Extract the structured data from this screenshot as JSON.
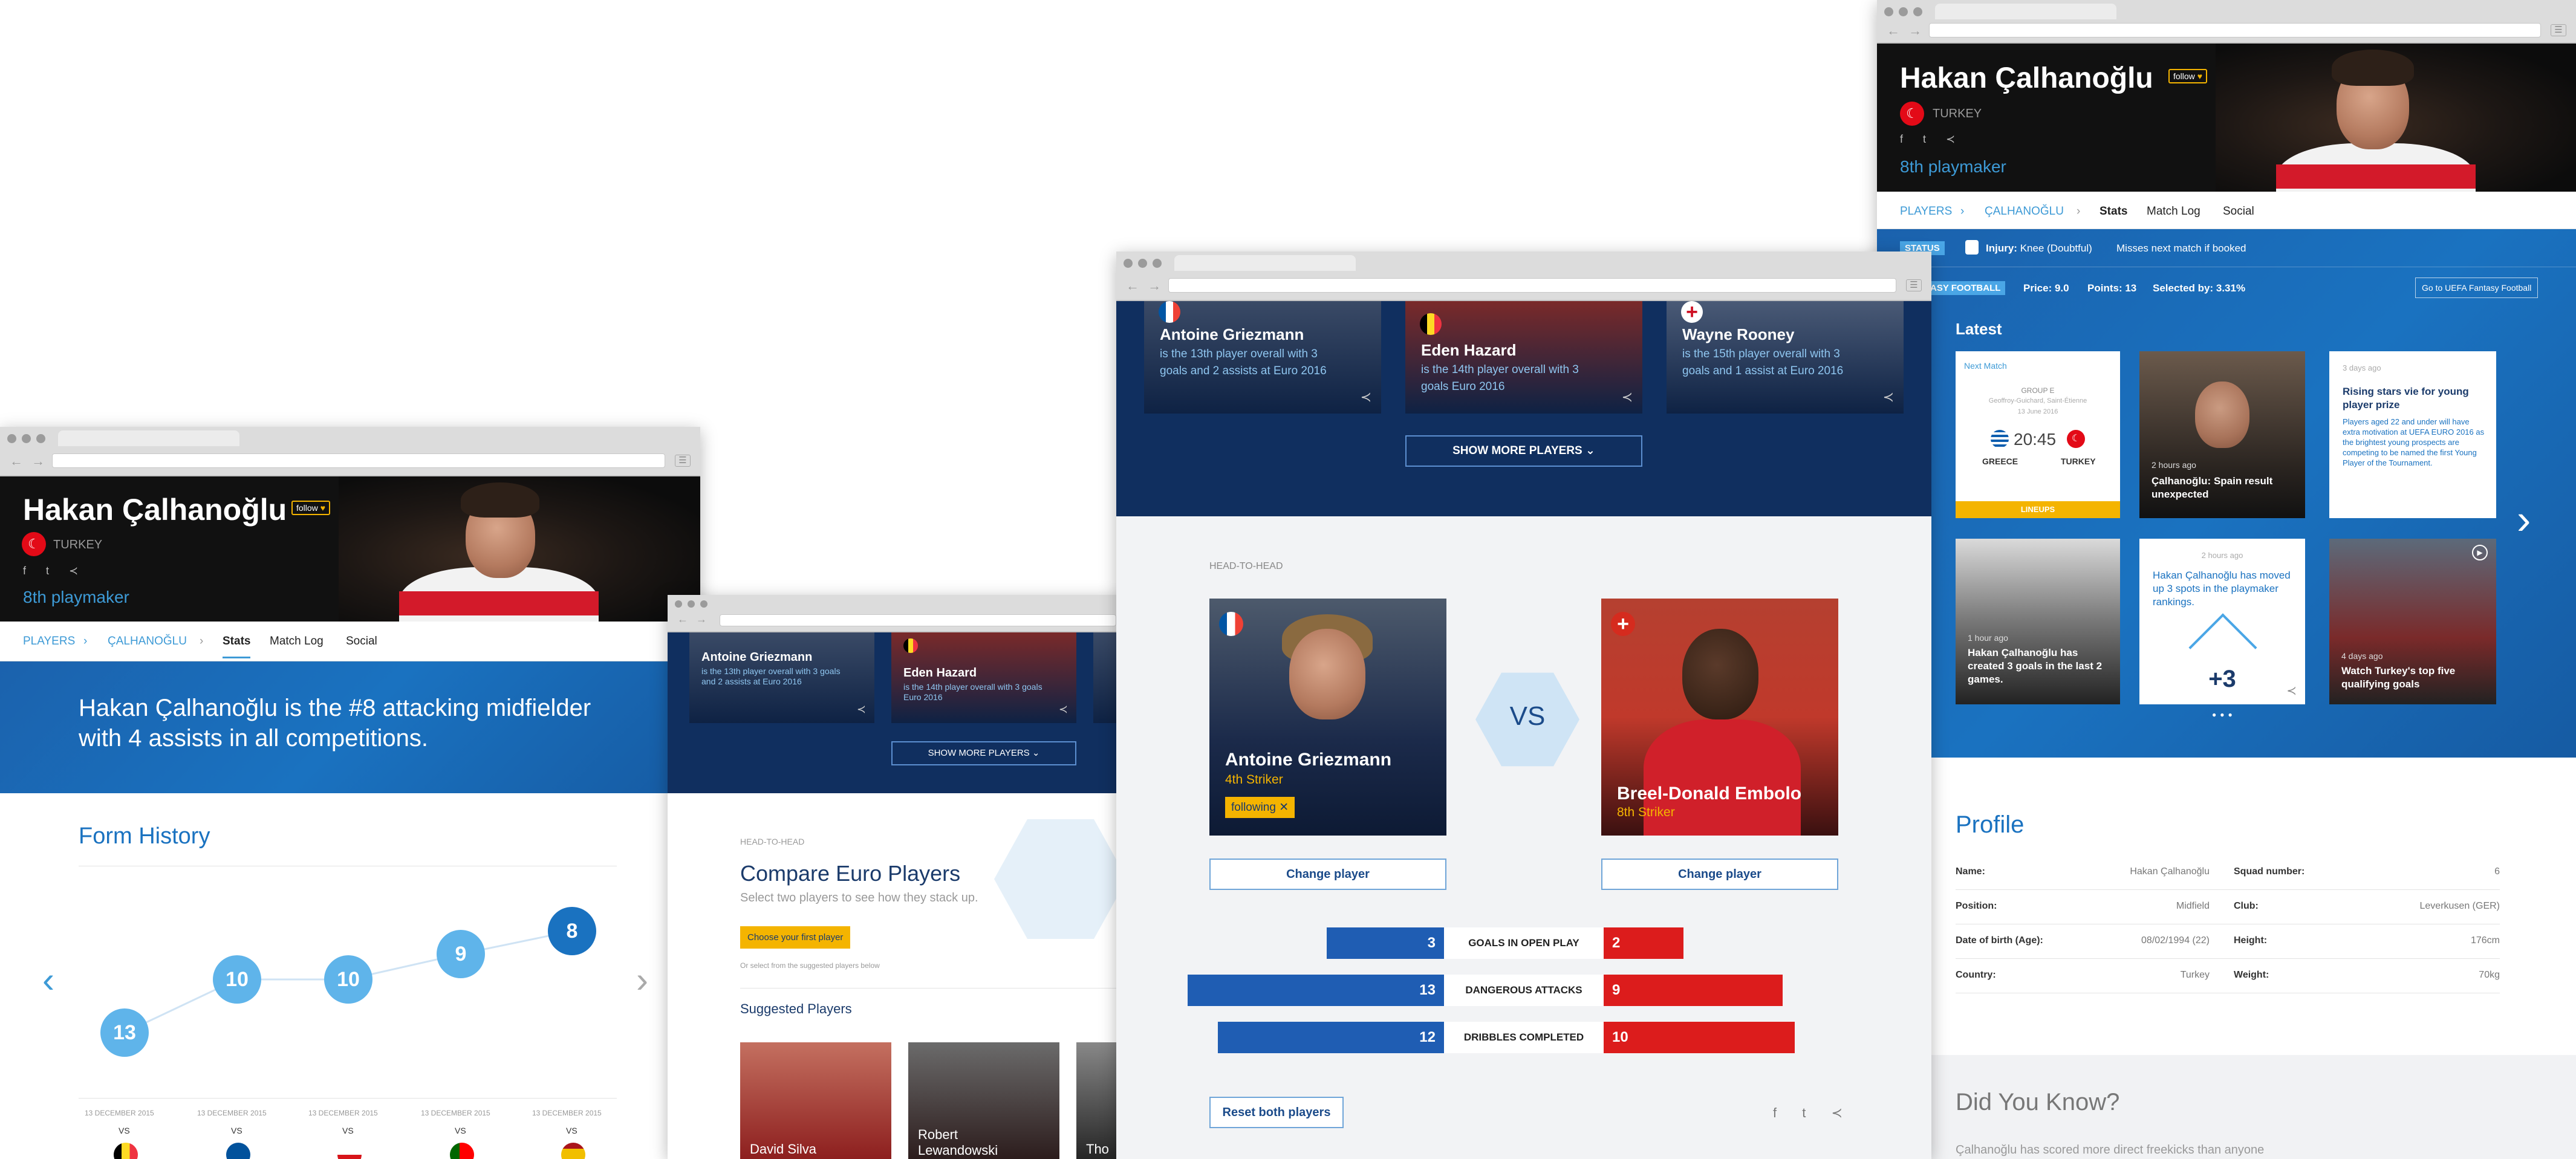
{
  "player": {
    "name": "Hakan Çalhanoğlu",
    "follow": "follow",
    "country": "TURKEY",
    "rank": "8th playmaker"
  },
  "subnav": [
    "PLAYERS",
    "ÇALHANOĞLU",
    "Stats",
    "Match Log",
    "Social"
  ],
  "headline": "Hakan Çalhanoğlu is the #8 attacking midfielder with 4 assists in all competitions.",
  "form_history": {
    "title": "Form History",
    "values": [
      "13",
      "10",
      "10",
      "9",
      "8"
    ],
    "date": "13 DECEMBER 2015",
    "vs": "VS"
  },
  "top_players": [
    {
      "name": "Antoine Griezmann",
      "desc": "is the 13th player overall with 3 goals and 2 assists at Euro 2016"
    },
    {
      "name": "Eden Hazard",
      "desc": "is the 14th player overall with 3 goals Euro 2016"
    },
    {
      "name": "Wayne Rooney",
      "desc": "is the 15th player overall with 3 goals and 1 assist at Euro 2016"
    }
  ],
  "show_more": "SHOW MORE PLAYERS",
  "compare": {
    "eyebrow": "HEAD-TO-HEAD",
    "title": "Compare Euro Players",
    "subtitle": "Select two players to see how they stack up.",
    "choose": "Choose your first player",
    "or": "Or select from the suggested players below",
    "suggested": "Suggested Players",
    "suggested_players": [
      "David Silva",
      "Robert Lewandowski",
      "Tho"
    ]
  },
  "h2h": {
    "eyebrow": "HEAD-TO-HEAD",
    "vs": "VS",
    "p1": {
      "name": "Antoine Griezmann",
      "role": "4th Striker",
      "following": "following"
    },
    "p2": {
      "name": "Breel-Donald Embolo",
      "role": "8th Striker"
    },
    "change": "Change player",
    "stats": [
      {
        "label": "GOALS IN OPEN PLAY",
        "left": "3",
        "right": "2"
      },
      {
        "label": "DANGEROUS ATTACKS",
        "left": "13",
        "right": "9"
      },
      {
        "label": "DRIBBLES COMPLETED",
        "left": "12",
        "right": "10"
      }
    ],
    "reset": "Reset both players"
  },
  "right_page": {
    "status_tag": "STATUS",
    "injury_label": "Injury:",
    "injury_value": "Knee (Doubtful)",
    "injury_note": "Misses next match if booked",
    "fantasy_tag": "ASY FOOTBALL",
    "price": "Price: 9.0",
    "points": "Points: 13",
    "selected": "Selected by: 3.31%",
    "fantasy_btn": "Go to UEFA Fantasy Football",
    "latest": "Latest",
    "next_match": {
      "label": "Next Match",
      "group": "GROUP E",
      "venue": "Geoffroy-Guichard, Saint-Étienne",
      "date": "13 June 2016",
      "time": "20:45",
      "home": "GREECE",
      "away": "TURKEY",
      "lineups": "LINEUPS"
    },
    "news": [
      {
        "time": "2 hours ago",
        "title": "Çalhanoğlu: Spain result unexpected"
      },
      {
        "time": "3 days ago",
        "title": "Rising stars vie for young player prize",
        "body": "Players aged 22 and under will have extra motivation at UEFA EURO 2016 as the brightest young prospects are competing to be named the first Young Player of the Tournament."
      },
      {
        "time": "1 hour ago",
        "title": "Hakan Çalhanoğlu has created 3 goals in the last 2 games."
      },
      {
        "time": "2 hours ago",
        "title": "Hakan Çalhanoğlu has moved up 3 spots in the playmaker rankings.",
        "delta": "+3"
      },
      {
        "time": "4 days ago",
        "title": "Watch Turkey's top five qualifying goals"
      }
    ],
    "profile": {
      "title": "Profile",
      "rows": [
        {
          "k": "Name:",
          "v": "Hakan Çalhanoğlu",
          "k2": "Squad number:",
          "v2": "6"
        },
        {
          "k": "Position:",
          "v": "Midfield",
          "k2": "Club:",
          "v2": "Leverkusen (GER)"
        },
        {
          "k": "Date of birth (Age):",
          "v": "08/02/1994 (22)",
          "k2": "Height:",
          "v2": "176cm"
        },
        {
          "k": "Country:",
          "v": "Turkey",
          "k2": "Weight:",
          "v2": "70kg"
        }
      ]
    },
    "dyk": {
      "title": "Did You Know?",
      "text": "Çalhanoğlu has scored more direct freekicks than anyone"
    }
  },
  "colors": {
    "accent": "#3d9ad6",
    "navy": "#102f5f",
    "red": "#dc1c1c",
    "barblue": "#1f5db3",
    "gold": "#f4b400"
  }
}
